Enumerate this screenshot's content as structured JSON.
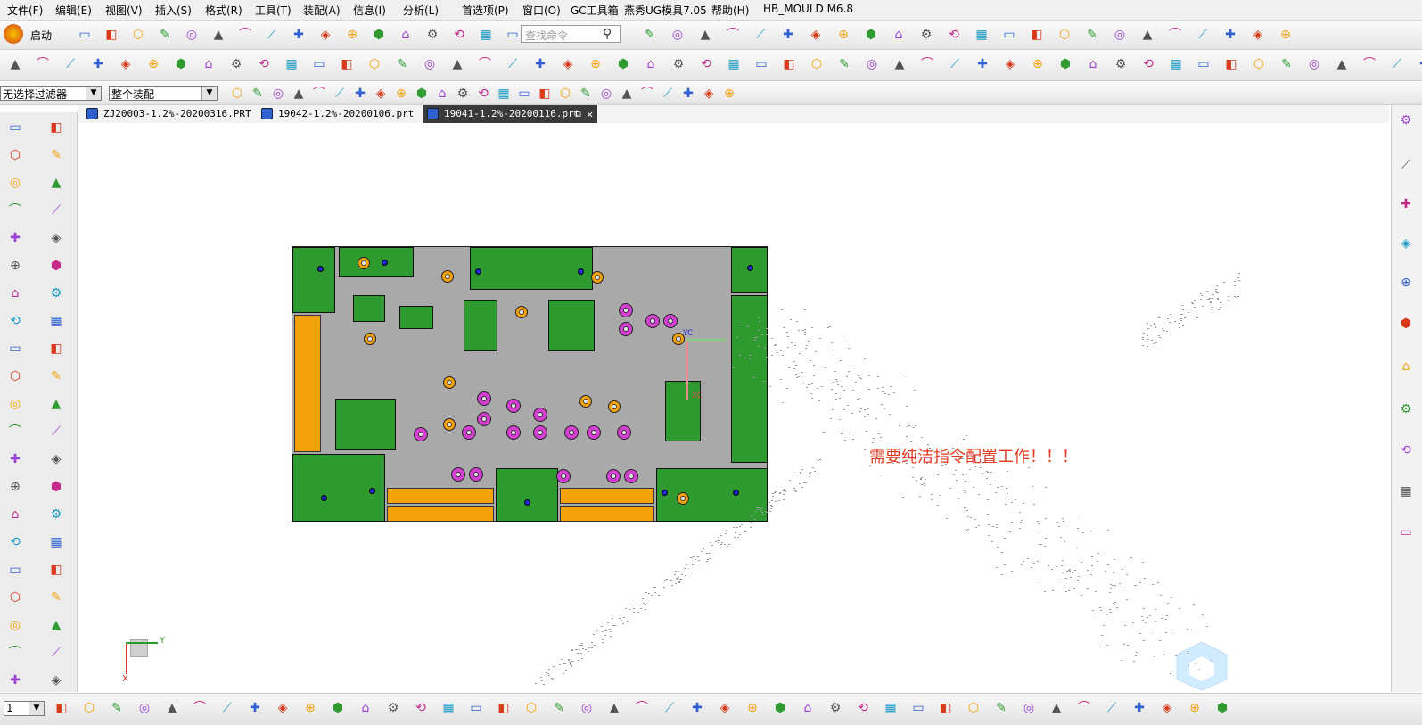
{
  "menu": [
    "文件(F)",
    "编辑(E)",
    "视图(V)",
    "插入(S)",
    "格式(R)",
    "工具(T)",
    "装配(A)",
    "信息(I)",
    "分析(L)",
    "首选项(P)",
    "窗口(O)",
    "GC工具箱",
    "燕秀UG模具7.05",
    "帮助(H)",
    "HB_MOULD M6.8"
  ],
  "toolbar": {
    "start_label": "启动",
    "search_placeholder": "查找命令"
  },
  "selection_bar": {
    "filter_value": "无选择过滤器",
    "scope_value": "整个装配"
  },
  "tabs": [
    {
      "label": "ZJ20003-1.2%-20200316.PRT",
      "active": false
    },
    {
      "label": "19042-1.2%-20200106.prt",
      "active": false
    },
    {
      "label": "19041-1.2%-20200116.prt",
      "active": true
    }
  ],
  "canvas": {
    "note": "需要纯洁指令配置工作！！！",
    "note_color": "#e23a1f",
    "axis_y_label": "Y",
    "axis_x_label": "X",
    "wcs_label_xc": "XC",
    "wcs_label_yc": "YC"
  },
  "bottom": {
    "layer_value": "1"
  },
  "colors": {
    "pcb_green": "#2f9a30",
    "pcb_gray": "#a9a9a9",
    "pin_orange": "#f4a20c",
    "hole_magenta": "#d33fd0"
  }
}
